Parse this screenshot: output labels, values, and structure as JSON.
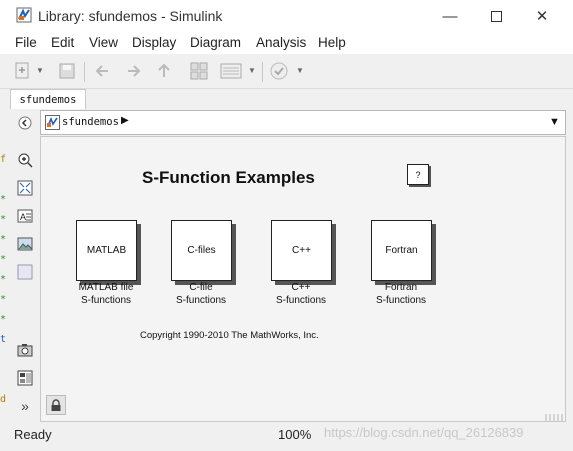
{
  "window": {
    "title": "Library: sfundemos - Simulink"
  },
  "menu": [
    "File",
    "Edit",
    "View",
    "Display",
    "Diagram",
    "Analysis",
    "Help"
  ],
  "tab": {
    "label": "sfundemos"
  },
  "breadcrumb": {
    "label": "sfundemos"
  },
  "canvas": {
    "title": "S-Function Examples",
    "help_button": "?",
    "blocks": [
      {
        "label": "MATLAB",
        "caption_line1": "MATLAB file",
        "caption_line2": "S-functions"
      },
      {
        "label": "C-files",
        "caption_line1": "C-file",
        "caption_line2": "S-functions"
      },
      {
        "label": "C++",
        "caption_line1": "C++",
        "caption_line2": "S-functions"
      },
      {
        "label": "Fortran",
        "caption_line1": "Fortran",
        "caption_line2": "S-functions"
      }
    ],
    "copyright": "Copyright 1990-2010 The MathWorks, Inc."
  },
  "status": {
    "state": "Ready",
    "zoom": "100%",
    "watermark": "https://blog.csdn.net/qq_26126839"
  },
  "left_edge_glyphs": [
    "f",
    "*",
    "*",
    "*",
    "*",
    "*",
    "*",
    "*",
    "t",
    "d"
  ],
  "colors": {
    "accent_blue": "#1f5fbf",
    "check_green": "#3a8a3a"
  }
}
